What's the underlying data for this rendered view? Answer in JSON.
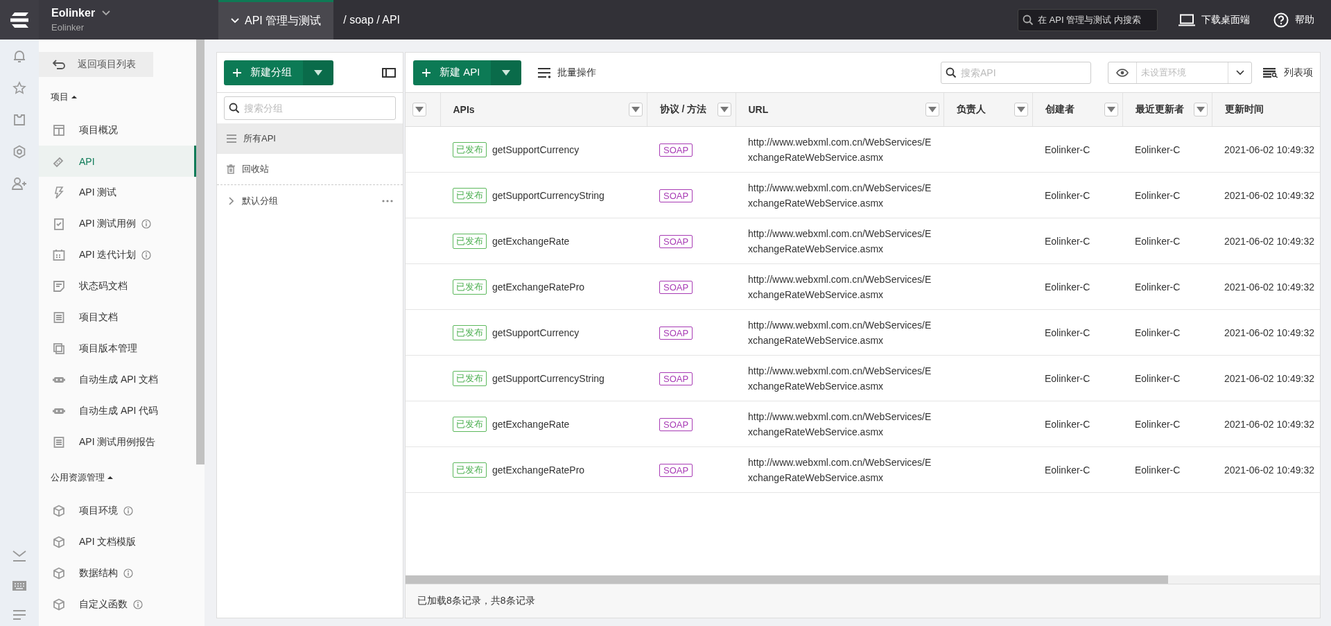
{
  "topbar": {
    "workspace": "Eolinker",
    "workspace_sub": "Eolinker",
    "module_tab": "API 管理与测试",
    "breadcrumb": "/ soap / API",
    "search": {
      "placeholder": "在 API 管理与测试 内搜索"
    },
    "download": "下载桌面端",
    "help": "帮助"
  },
  "sidebar": {
    "back": "返回项目列表",
    "sections": [
      {
        "title": "项目",
        "expanded": true,
        "items": [
          {
            "label": "项目概况",
            "info": false,
            "selected": false
          },
          {
            "label": "API",
            "info": false,
            "selected": true
          },
          {
            "label": "API 测试",
            "info": false,
            "selected": false
          },
          {
            "label": "API 测试用例",
            "info": true,
            "selected": false
          },
          {
            "label": "API 迭代计划",
            "info": true,
            "selected": false
          },
          {
            "label": "状态码文档",
            "info": false,
            "selected": false
          },
          {
            "label": "项目文档",
            "info": false,
            "selected": false
          },
          {
            "label": "项目版本管理",
            "info": false,
            "selected": false
          },
          {
            "label": "自动生成 API 文档",
            "info": false,
            "selected": false
          },
          {
            "label": "自动生成 API 代码",
            "info": false,
            "selected": false
          },
          {
            "label": "API 测试用例报告",
            "info": false,
            "selected": false
          }
        ]
      },
      {
        "title": "公用资源管理",
        "expanded": true,
        "items": [
          {
            "label": "项目环境",
            "info": true,
            "selected": false
          },
          {
            "label": "API 文档模版",
            "info": false,
            "selected": false
          },
          {
            "label": "数据结构",
            "info": true,
            "selected": false
          },
          {
            "label": "自定义函数",
            "info": true,
            "selected": false
          }
        ]
      }
    ]
  },
  "groups": {
    "new_button": "新建分组",
    "search": {
      "placeholder": "搜索分组"
    },
    "items": [
      {
        "label": "所有API",
        "selected": true
      },
      {
        "label": "回收站",
        "selected": false
      }
    ],
    "tree": [
      {
        "label": "默认分组",
        "expanded": false
      }
    ]
  },
  "apis": {
    "new_button": "新建 API",
    "batch": "批量操作",
    "search": {
      "placeholder": "搜索API"
    },
    "env": {
      "placeholder": "未设置环境"
    },
    "columns_button": "列表项",
    "table": {
      "columns": [
        {
          "label": "APIs",
          "filter": true
        },
        {
          "label": "协议 / 方法",
          "filter": true
        },
        {
          "label": "URL",
          "filter": true
        },
        {
          "label": "负责人",
          "filter": true
        },
        {
          "label": "创建者",
          "filter": true
        },
        {
          "label": "最近更新者",
          "filter": true
        },
        {
          "label": "更新时间",
          "filter": false
        }
      ],
      "rows": [
        {
          "status": "已发布",
          "name": "getSupportCurrency",
          "protocol": "SOAP",
          "url": "http://www.webxml.com.cn/WebServices/ExchangeRateWebService.asmx",
          "creator": "Eolinker-C",
          "updater": "Eolinker-C",
          "updated": "2021-06-02 10:49:32"
        },
        {
          "status": "已发布",
          "name": "getSupportCurrencyString",
          "protocol": "SOAP",
          "url": "http://www.webxml.com.cn/WebServices/ExchangeRateWebService.asmx",
          "creator": "Eolinker-C",
          "updater": "Eolinker-C",
          "updated": "2021-06-02 10:49:32"
        },
        {
          "status": "已发布",
          "name": "getExchangeRate",
          "protocol": "SOAP",
          "url": "http://www.webxml.com.cn/WebServices/ExchangeRateWebService.asmx",
          "creator": "Eolinker-C",
          "updater": "Eolinker-C",
          "updated": "2021-06-02 10:49:32"
        },
        {
          "status": "已发布",
          "name": "getExchangeRatePro",
          "protocol": "SOAP",
          "url": "http://www.webxml.com.cn/WebServices/ExchangeRateWebService.asmx",
          "creator": "Eolinker-C",
          "updater": "Eolinker-C",
          "updated": "2021-06-02 10:49:32"
        },
        {
          "status": "已发布",
          "name": "getSupportCurrency",
          "protocol": "SOAP",
          "url": "http://www.webxml.com.cn/WebServices/ExchangeRateWebService.asmx",
          "creator": "Eolinker-C",
          "updater": "Eolinker-C",
          "updated": "2021-06-02 10:49:32"
        },
        {
          "status": "已发布",
          "name": "getSupportCurrencyString",
          "protocol": "SOAP",
          "url": "http://www.webxml.com.cn/WebServices/ExchangeRateWebService.asmx",
          "creator": "Eolinker-C",
          "updater": "Eolinker-C",
          "updated": "2021-06-02 10:49:32"
        },
        {
          "status": "已发布",
          "name": "getExchangeRate",
          "protocol": "SOAP",
          "url": "http://www.webxml.com.cn/WebServices/ExchangeRateWebService.asmx",
          "creator": "Eolinker-C",
          "updater": "Eolinker-C",
          "updated": "2021-06-02 10:49:32"
        },
        {
          "status": "已发布",
          "name": "getExchangeRatePro",
          "protocol": "SOAP",
          "url": "http://www.webxml.com.cn/WebServices/ExchangeRateWebService.asmx",
          "creator": "Eolinker-C",
          "updater": "Eolinker-C",
          "updated": "2021-06-02 10:49:32"
        }
      ]
    },
    "footer": "已加载8条记录，共8条记录"
  }
}
